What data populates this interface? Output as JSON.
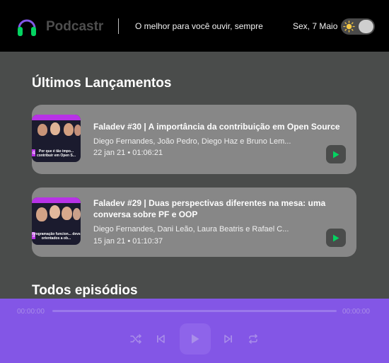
{
  "header": {
    "app_name": "Podcastr",
    "tagline": "O melhor para você ouvir, sempre",
    "date": "Sex, 7 Maio"
  },
  "latest": {
    "title": "Últimos Lançamentos",
    "episodes": [
      {
        "title": "Faladev #30 | A importância da contribuição em Open Source",
        "members": "Diego Fernandes, João Pedro, Diego Haz e Bruno Lem...",
        "published_at": "22 jan 21",
        "duration": "01:06:21",
        "thumb_caption": "Por que é tão impo... contribuir em Open S...",
        "thumb_number": "4"
      },
      {
        "title": "Faladev #29 | Duas perspectivas diferentes na mesa: uma conversa sobre PF e OOP",
        "members": "Diego Fernandes, Dani Leão, Laura Beatris e Rafael C...",
        "published_at": "15 jan 21",
        "duration": "01:10:37",
        "thumb_caption": "Programação funcion... devs orientados a ob...",
        "thumb_number": "3"
      }
    ]
  },
  "all": {
    "title": "Todos episódios"
  },
  "player": {
    "current_time": "00:00:00",
    "total_time": "00:00:00"
  },
  "colors": {
    "header_bg": "#000000",
    "page_bg": "#4a4c4b",
    "card_bg": "#878787",
    "player_bg": "#8356e6",
    "play_green": "#04d361",
    "thumb_accent": "#b832e6"
  },
  "icons": {
    "logo": "headphones-icon",
    "theme": "sun-icon",
    "play": "play-icon",
    "shuffle": "shuffle-icon",
    "previous": "skip-previous-icon",
    "next": "skip-next-icon",
    "repeat": "repeat-icon"
  }
}
